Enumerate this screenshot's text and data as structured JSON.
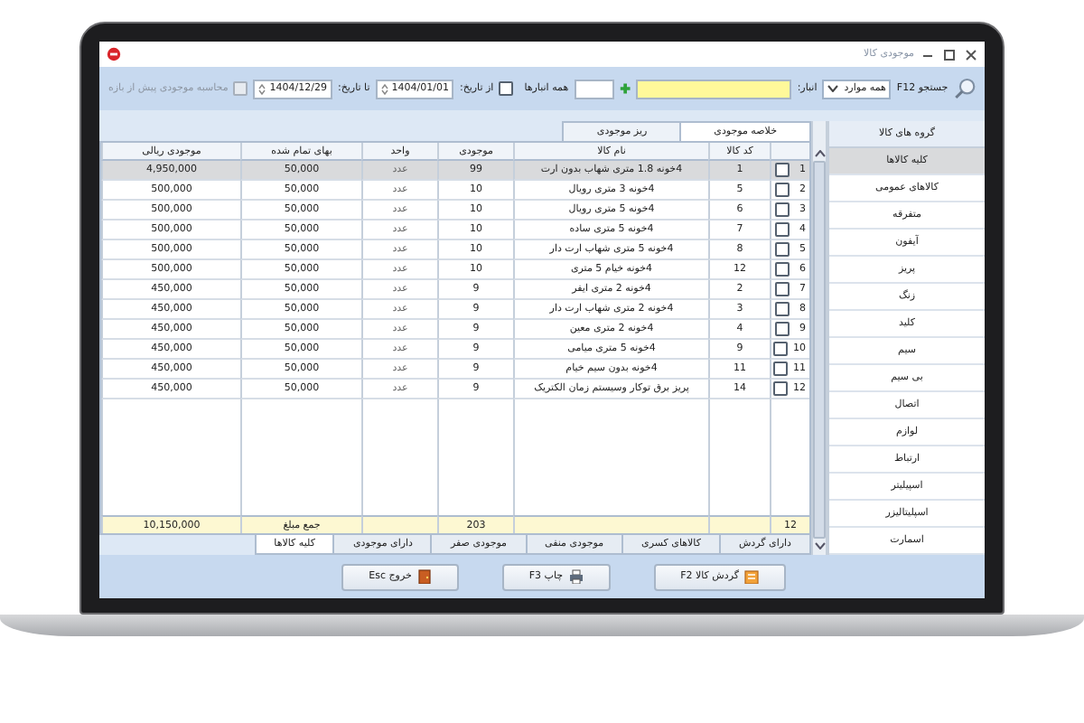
{
  "window": {
    "title": "موجودی کالا"
  },
  "toolbar": {
    "search_label": "جستجو F12",
    "scope": "همه موارد",
    "warehouse_label": "انبار:",
    "warehouse_scope": "همه انبارها",
    "from_date": {
      "label": "از تاریخ:",
      "checked": false,
      "value": "1404/01/01"
    },
    "to_date": {
      "label": "تا تاریخ:",
      "value": "1404/12/29"
    },
    "pre_period": {
      "label": "محاسبه موجودی پیش از بازه",
      "checked": false,
      "disabled": true
    }
  },
  "sidebar": {
    "title": "گروه های کالا",
    "items": [
      {
        "label": "کلیه کالاها",
        "selected": true
      },
      {
        "label": "کالاهای عمومی",
        "selected": false
      },
      {
        "label": "متفرقه",
        "selected": false
      },
      {
        "label": "آیفون",
        "selected": false
      },
      {
        "label": "پریز",
        "selected": false
      },
      {
        "label": "زنگ",
        "selected": false
      },
      {
        "label": "کلید",
        "selected": false
      },
      {
        "label": "سیم",
        "selected": false
      },
      {
        "label": "بی سیم",
        "selected": false
      },
      {
        "label": "اتصال",
        "selected": false
      },
      {
        "label": "لوازم",
        "selected": false
      },
      {
        "label": "ارتباط",
        "selected": false
      },
      {
        "label": "اسپیلیتر",
        "selected": false
      },
      {
        "label": "اسپلیتالیزر",
        "selected": false
      },
      {
        "label": "اسمارت",
        "selected": false
      }
    ]
  },
  "view_tabs": [
    {
      "label": "خلاصه موجودی",
      "selected": true
    },
    {
      "label": "ریز موجودی",
      "selected": false
    }
  ],
  "table": {
    "columns": [
      "کد کالا",
      "نام کالا",
      "موجودی",
      "واحد",
      "بهای تمام شده",
      "موجودی ریالی"
    ],
    "rows": [
      {
        "number": "1",
        "checked": false,
        "selected": true,
        "code": "1",
        "name": "4خونه 1.8 متری شهاب بدون ارت",
        "quantity": "99",
        "unit": "عدد",
        "unit_cost": "50,000",
        "value": "4,950,000"
      },
      {
        "number": "2",
        "checked": false,
        "selected": false,
        "code": "5",
        "name": "4خونه 3 متری رویال",
        "quantity": "10",
        "unit": "عدد",
        "unit_cost": "50,000",
        "value": "500,000"
      },
      {
        "number": "3",
        "checked": false,
        "selected": false,
        "code": "6",
        "name": "4خونه 5 متری رویال",
        "quantity": "10",
        "unit": "عدد",
        "unit_cost": "50,000",
        "value": "500,000"
      },
      {
        "number": "4",
        "checked": false,
        "selected": false,
        "code": "7",
        "name": "4خونه 5 متری ساده",
        "quantity": "10",
        "unit": "عدد",
        "unit_cost": "50,000",
        "value": "500,000"
      },
      {
        "number": "5",
        "checked": false,
        "selected": false,
        "code": "8",
        "name": "4خونه 5 متری شهاب ارت دار",
        "quantity": "10",
        "unit": "عدد",
        "unit_cost": "50,000",
        "value": "500,000"
      },
      {
        "number": "6",
        "checked": false,
        "selected": false,
        "code": "12",
        "name": "4خونه خیام 5 متری",
        "quantity": "10",
        "unit": "عدد",
        "unit_cost": "50,000",
        "value": "500,000"
      },
      {
        "number": "7",
        "checked": false,
        "selected": false,
        "code": "2",
        "name": "4خونه 2 متری ایفر",
        "quantity": "9",
        "unit": "عدد",
        "unit_cost": "50,000",
        "value": "450,000"
      },
      {
        "number": "8",
        "checked": false,
        "selected": false,
        "code": "3",
        "name": "4خونه 2 متری شهاب ارت دار",
        "quantity": "9",
        "unit": "عدد",
        "unit_cost": "50,000",
        "value": "450,000"
      },
      {
        "number": "9",
        "checked": false,
        "selected": false,
        "code": "4",
        "name": "4خونه 2 متری معین",
        "quantity": "9",
        "unit": "عدد",
        "unit_cost": "50,000",
        "value": "450,000"
      },
      {
        "number": "10",
        "checked": false,
        "selected": false,
        "code": "9",
        "name": "4خونه 5 متری میامی",
        "quantity": "9",
        "unit": "عدد",
        "unit_cost": "50,000",
        "value": "450,000"
      },
      {
        "number": "11",
        "checked": false,
        "selected": false,
        "code": "11",
        "name": "4خونه بدون سیم خیام",
        "quantity": "9",
        "unit": "عدد",
        "unit_cost": "50,000",
        "value": "450,000"
      },
      {
        "number": "12",
        "checked": false,
        "selected": false,
        "code": "14",
        "name": "پریز برق توکار وسیستم زمان الکتریک",
        "quantity": "9",
        "unit": "عدد",
        "unit_cost": "50,000",
        "value": "450,000"
      }
    ],
    "footer": {
      "count": "12",
      "quantity_total": "203",
      "total_label": "جمع مبلغ",
      "value_total": "10,150,000"
    }
  },
  "filter_tabs": [
    {
      "label": "دارای گردش",
      "selected": false
    },
    {
      "label": "کالاهای کسری",
      "selected": false
    },
    {
      "label": "موجودی منفی",
      "selected": false
    },
    {
      "label": "موجودی صفر",
      "selected": false
    },
    {
      "label": "دارای موجودی",
      "selected": false
    },
    {
      "label": "کلیه کالاها",
      "selected": true
    }
  ],
  "buttons": [
    {
      "label": "گردش کالا F2",
      "kind": "ledger"
    },
    {
      "label": "چاپ F3",
      "kind": "printer"
    },
    {
      "label": "خروج Esc",
      "kind": "door"
    }
  ]
}
